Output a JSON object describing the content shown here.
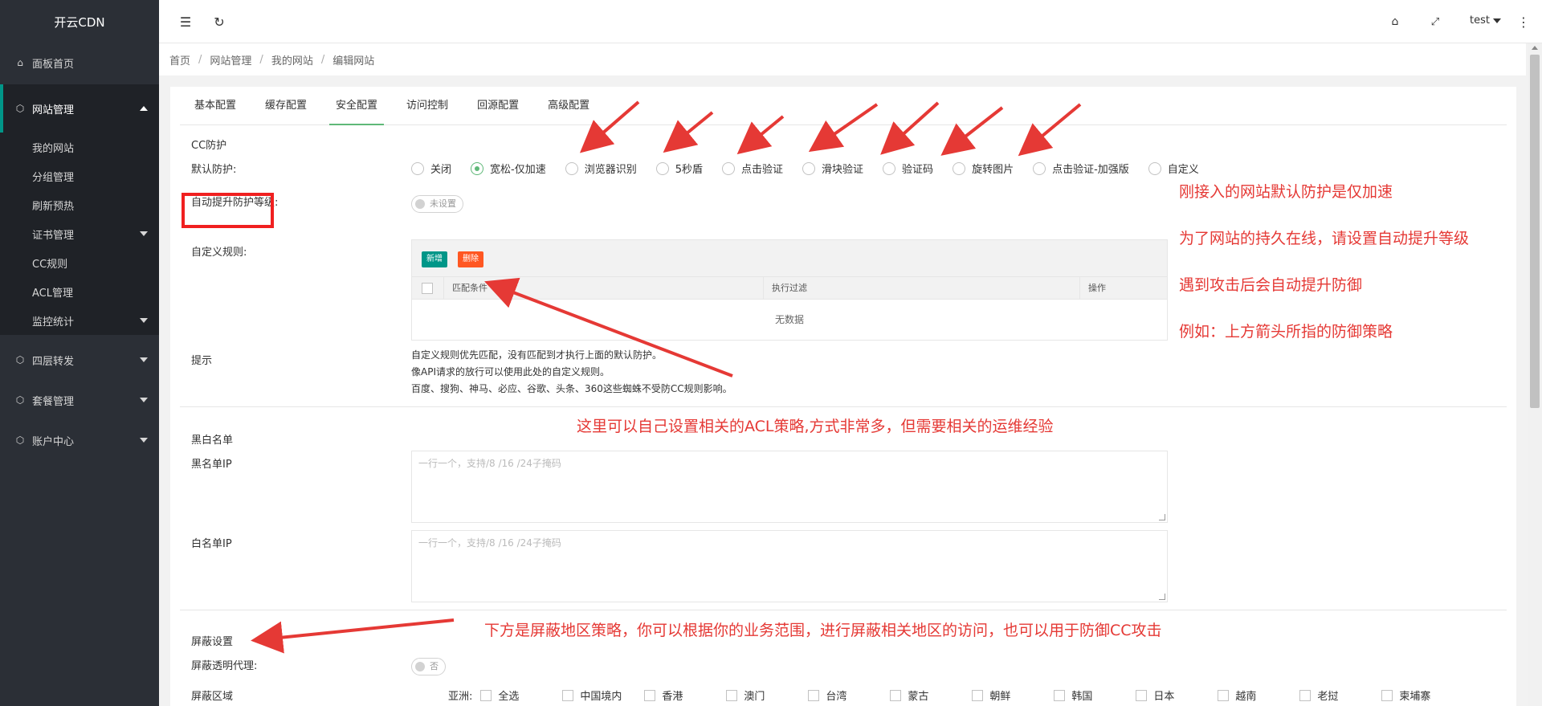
{
  "app": {
    "logo": "开云CDN"
  },
  "sidebar": {
    "items": [
      {
        "label": "面板首页",
        "icon": "home-icon"
      },
      {
        "label": "网站管理",
        "icon": "cube-icon",
        "expanded": true
      },
      {
        "label": "四层转发",
        "icon": "cube-icon"
      },
      {
        "label": "套餐管理",
        "icon": "cube-icon"
      },
      {
        "label": "账户中心",
        "icon": "cube-icon"
      }
    ],
    "sub_items": [
      {
        "label": "我的网站"
      },
      {
        "label": "分组管理"
      },
      {
        "label": "刷新预热"
      },
      {
        "label": "证书管理"
      },
      {
        "label": "CC规则"
      },
      {
        "label": "ACL管理"
      },
      {
        "label": "监控统计"
      }
    ]
  },
  "topbar": {
    "user": "test",
    "menu_icon": "menu-fold-icon",
    "refresh_icon": "refresh-icon",
    "tag_icon": "tag-icon",
    "fullscreen_icon": "fullscreen-icon",
    "more_icon": "more-vertical-icon"
  },
  "breadcrumb": [
    "首页",
    "网站管理",
    "我的网站",
    "编辑网站"
  ],
  "tabs": [
    "基本配置",
    "缓存配置",
    "安全配置",
    "访问控制",
    "回源配置",
    "高级配置"
  ],
  "active_tab": "安全配置",
  "cc": {
    "section_title": "CC防护",
    "default_label": "默认防护:",
    "options": [
      "关闭",
      "宽松-仅加速",
      "浏览器识别",
      "5秒盾",
      "点击验证",
      "滑块验证",
      "验证码",
      "旋转图片",
      "点击验证-加强版",
      "自定义"
    ],
    "selected": "宽松-仅加速",
    "auto_label": "自动提升防护等级:",
    "auto_switch": "未设置",
    "custom_label": "自定义规则:",
    "add_btn": "新增",
    "del_btn": "删除",
    "col_match": "匹配条件",
    "col_filter": "执行过滤",
    "col_op": "操作",
    "empty": "无数据",
    "tip_label": "提示",
    "tips": [
      "自定义规则优先匹配，没有匹配到才执行上面的默认防护。",
      "像API请求的放行可以使用此处的自定义规则。",
      "百度、搜狗、神马、必应、谷歌、头条、360这些蜘蛛不受防CC规则影响。"
    ]
  },
  "bw": {
    "section_title": "黑白名单",
    "black_label": "黑名单IP",
    "black_placeholder": "一行一个，支持/8 /16 /24子掩码",
    "white_label": "白名单IP",
    "white_placeholder": "一行一个，支持/8 /16 /24子掩码"
  },
  "block": {
    "section_title": "屏蔽设置",
    "proxy_label": "屏蔽透明代理:",
    "proxy_switch": "否",
    "region_label": "屏蔽区域",
    "asia_label": "亚洲:",
    "regions": [
      "全选",
      "中国境内",
      "香港",
      "澳门",
      "台湾",
      "蒙古",
      "朝鲜",
      "韩国",
      "日本",
      "越南",
      "老挝",
      "柬埔寨"
    ]
  },
  "annotations": {
    "right_1": "刚接入的网站默认防护是仅加速",
    "right_2": "为了网站的持久在线，请设置自动提升等级",
    "right_3": "遇到攻击后会自动提升防御",
    "right_4": "例如：上方箭头所指的防御策略",
    "acl": "这里可以自己设置相关的ACL策略,方式非常多，但需要相关的运维经验",
    "region": "下方是屏蔽地区策略，你可以根据你的业务范围，进行屏蔽相关地区的访问，也可以用于防御CC攻击"
  },
  "colors": {
    "accent": "#5FB878",
    "teal": "#009688",
    "orange": "#FF5722",
    "annotation": "#e53935",
    "sidebar": "#2b2f36"
  }
}
